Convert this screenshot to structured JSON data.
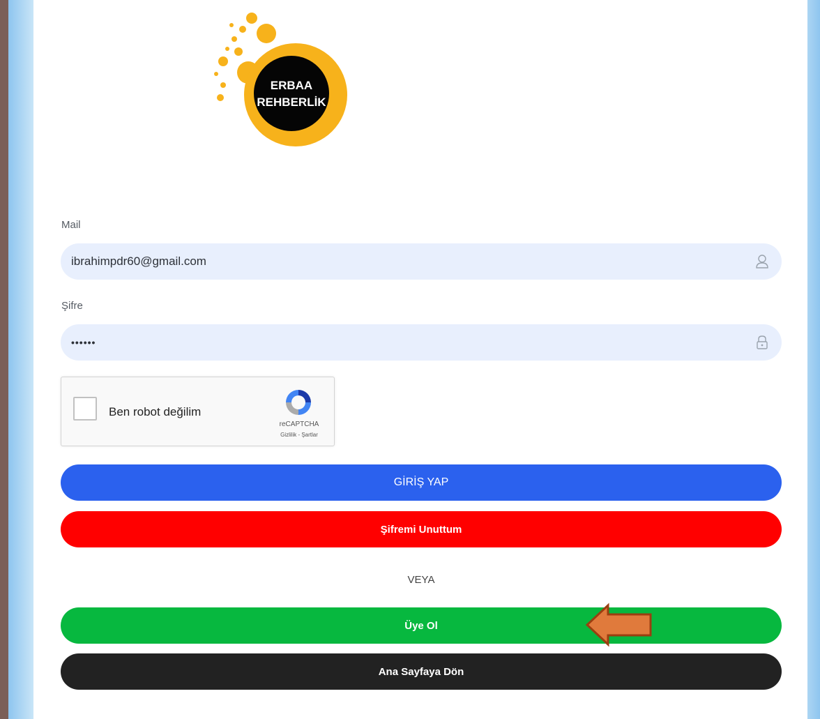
{
  "logo": {
    "line1": "ERBAA",
    "line2": "REHBERLİK",
    "colors": {
      "ring": "#f7b21b",
      "center": "#050505",
      "text": "#ffffff"
    }
  },
  "form": {
    "mail_label": "Mail",
    "mail_value": "ibrahimpdr60@gmail.com",
    "mail_icon": "user-icon",
    "password_label": "Şifre",
    "password_value": "••••••",
    "password_icon": "lock-icon"
  },
  "captcha": {
    "label": "Ben robot değilim",
    "brand": "reCAPTCHA",
    "links": "Gizlilik - Şartlar",
    "checked": false
  },
  "buttons": {
    "login": "GİRİŞ YAP",
    "forgot": "Şifremi Unuttum",
    "divider": "VEYA",
    "register": "Üye Ol",
    "home": "Ana Sayfaya Dön"
  },
  "colors": {
    "login": "#2b61ee",
    "forgot": "#ff0000",
    "register": "#07b83f",
    "home": "#222222",
    "field_bg": "#e8effd",
    "annotation_arrow": "#e07a3c"
  }
}
